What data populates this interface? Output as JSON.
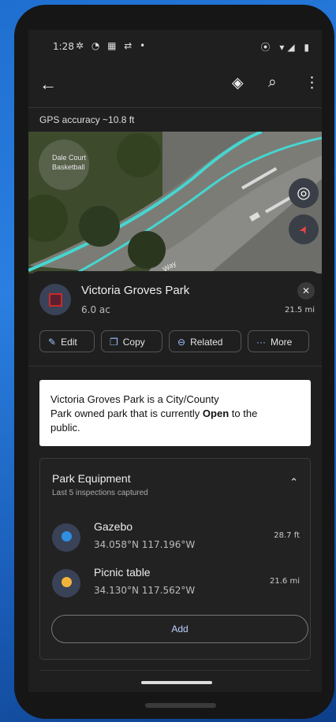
{
  "status_bar": {
    "time": "1:28",
    "left_icons": "✲ ◔ ▦ ⇄ •",
    "right_icons": "⦿ ▾◢ ▮"
  },
  "app_bar": {
    "back_icon": "←",
    "layers_icon": "◈",
    "search_icon": "⌕",
    "more_icon": "⋮"
  },
  "gps_accuracy": "GPS accuracy ~10.8 ft",
  "map": {
    "map_label_1": "Dale Court",
    "map_label_2": "Basketball",
    "road_label": "Way",
    "locate_icon": "◎",
    "compass_icon": "➤"
  },
  "park": {
    "title": "Victoria Groves Park",
    "area": "6.0 ac",
    "distance": "21.5 mi",
    "close_icon": "✕"
  },
  "actions": [
    {
      "icon": "✎",
      "label": "Edit"
    },
    {
      "icon": "❐",
      "label": "Copy"
    },
    {
      "icon": "⊖",
      "label": "Related"
    },
    {
      "icon": "···",
      "label": "More"
    }
  ],
  "description": {
    "line1": "Victoria Groves Park is a City/County",
    "line2_pre": "Park owned park that is currently ",
    "line2_bold": "Open",
    "line2_post": " to the",
    "line3": "public."
  },
  "equipment": {
    "title": "Park Equipment",
    "subtitle": "Last 5 inspections captured",
    "chevron": "⌃",
    "items": [
      {
        "name": "Gazebo",
        "coords": "34.058°N  117.196°W",
        "distance": "28.7 ft",
        "color": "#2f8fe0"
      },
      {
        "name": "Picnic table",
        "coords": "34.130°N  117.562°W",
        "distance": "21.6 mi",
        "color": "#f2b43a"
      }
    ],
    "add_label": "Add"
  }
}
